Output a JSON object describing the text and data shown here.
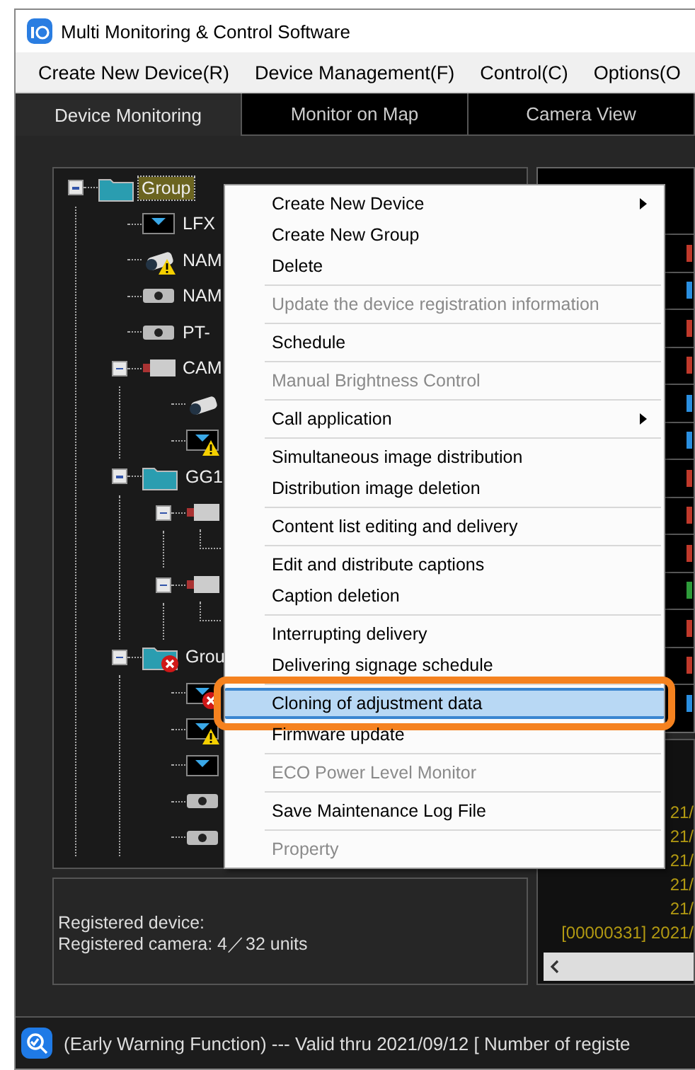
{
  "window": {
    "title": "Multi Monitoring & Control Software"
  },
  "menu_bar": [
    "Create New Device(R)",
    "Device Management(F)",
    "Control(C)",
    "Options(O"
  ],
  "tabs": [
    {
      "label": "Device Monitoring",
      "selected": true
    },
    {
      "label": "Monitor on Map",
      "selected": false
    },
    {
      "label": "Camera View",
      "selected": false
    }
  ],
  "tree": [
    {
      "label": "Group",
      "kind": "folder",
      "warning": false,
      "error": false,
      "expanded": true,
      "selected": true,
      "children": [
        {
          "label": "LFX",
          "kind": "display",
          "warning": false,
          "error": false,
          "selected": false
        },
        {
          "label": "NAM",
          "kind": "camera",
          "warning": true,
          "error": false,
          "selected": false
        },
        {
          "label": "NAM",
          "kind": "projector",
          "warning": false,
          "error": false,
          "selected": false
        },
        {
          "label": "PT-",
          "kind": "projector",
          "warning": false,
          "error": false,
          "selected": false
        },
        {
          "label": "CAM",
          "kind": "boxcam",
          "warning": false,
          "error": false,
          "expanded": true,
          "selected": false,
          "children": [
            {
              "kind": "camera",
              "warning": false,
              "error": false
            },
            {
              "kind": "display",
              "warning": true,
              "error": false
            }
          ]
        },
        {
          "label": "GG1",
          "kind": "folder",
          "warning": false,
          "error": false,
          "expanded": true,
          "selected": false,
          "children": [
            {
              "kind": "boxcam",
              "warning": false,
              "error": false,
              "expanded": true,
              "children": [
                {
                  "kind": "connector"
                }
              ]
            },
            {
              "kind": "boxcam",
              "warning": false,
              "error": false,
              "expanded": true,
              "children": [
                {
                  "kind": "connector"
                }
              ]
            }
          ]
        },
        {
          "label": "Grou",
          "kind": "folder",
          "warning": false,
          "error": true,
          "expanded": true,
          "selected": false,
          "children": [
            {
              "kind": "display",
              "warning": false,
              "error": true
            },
            {
              "kind": "display",
              "warning": true,
              "error": false
            },
            {
              "kind": "display",
              "warning": false,
              "error": false
            },
            {
              "kind": "projector",
              "warning": false,
              "error": false
            },
            {
              "kind": "projector",
              "warning": false,
              "error": false
            }
          ]
        }
      ]
    }
  ],
  "info": {
    "device": "Registered device:",
    "camera": "Registered camera: 4／32 units"
  },
  "device_table": {
    "rows": [
      {
        "color": "#c0392b"
      },
      {
        "color": "#2a8fe0"
      },
      {
        "color": "#c0392b"
      },
      {
        "color": "#c0392b"
      },
      {
        "color": "#2a8fe0"
      },
      {
        "color": "#2a8fe0"
      },
      {
        "color": "#c0392b"
      },
      {
        "color": "#c0392b"
      },
      {
        "color": "#c0392b"
      },
      {
        "color": "#2e9b3a"
      },
      {
        "color": "#c0392b"
      },
      {
        "color": "#c0392b"
      },
      {
        "color": "#2a8fe0"
      }
    ]
  },
  "log": [
    "21/",
    "21/",
    "21/",
    "21/",
    "21/",
    "[00000331] 2021/"
  ],
  "context_menu": [
    [
      {
        "label": "Create New Device",
        "submenu": true,
        "disabled": false,
        "selected": false
      },
      {
        "label": "Create New Group",
        "submenu": false,
        "disabled": false,
        "selected": false
      },
      {
        "label": "Delete",
        "submenu": false,
        "disabled": false,
        "selected": false
      }
    ],
    [
      {
        "label": "Update the device registration information",
        "submenu": false,
        "disabled": true,
        "selected": false
      }
    ],
    [
      {
        "label": "Schedule",
        "submenu": false,
        "disabled": false,
        "selected": false
      }
    ],
    [
      {
        "label": "Manual Brightness Control",
        "submenu": false,
        "disabled": true,
        "selected": false
      }
    ],
    [
      {
        "label": "Call application",
        "submenu": true,
        "disabled": false,
        "selected": false
      }
    ],
    [
      {
        "label": "Simultaneous image distribution",
        "submenu": false,
        "disabled": false,
        "selected": false
      },
      {
        "label": "Distribution image deletion",
        "submenu": false,
        "disabled": false,
        "selected": false
      }
    ],
    [
      {
        "label": "Content list editing and delivery",
        "submenu": false,
        "disabled": false,
        "selected": false
      }
    ],
    [
      {
        "label": "Edit and distribute captions",
        "submenu": false,
        "disabled": false,
        "selected": false
      },
      {
        "label": "Caption deletion",
        "submenu": false,
        "disabled": false,
        "selected": false
      }
    ],
    [
      {
        "label": "Interrupting delivery",
        "submenu": false,
        "disabled": false,
        "selected": false
      },
      {
        "label": "Delivering signage schedule",
        "submenu": false,
        "disabled": false,
        "selected": false
      }
    ],
    [
      {
        "label": "Cloning of adjustment data",
        "submenu": false,
        "disabled": false,
        "selected": true
      },
      {
        "label": "Firmware update",
        "submenu": false,
        "disabled": false,
        "selected": false
      }
    ],
    [
      {
        "label": "ECO Power Level Monitor",
        "submenu": false,
        "disabled": true,
        "selected": false
      }
    ],
    [
      {
        "label": "Save Maintenance Log File",
        "submenu": false,
        "disabled": false,
        "selected": false
      }
    ],
    [
      {
        "label": "Property",
        "submenu": false,
        "disabled": true,
        "selected": false
      }
    ]
  ],
  "status_bar": {
    "text": "(Early Warning Function) --- Valid thru 2021/09/12  [ Number of registe"
  }
}
